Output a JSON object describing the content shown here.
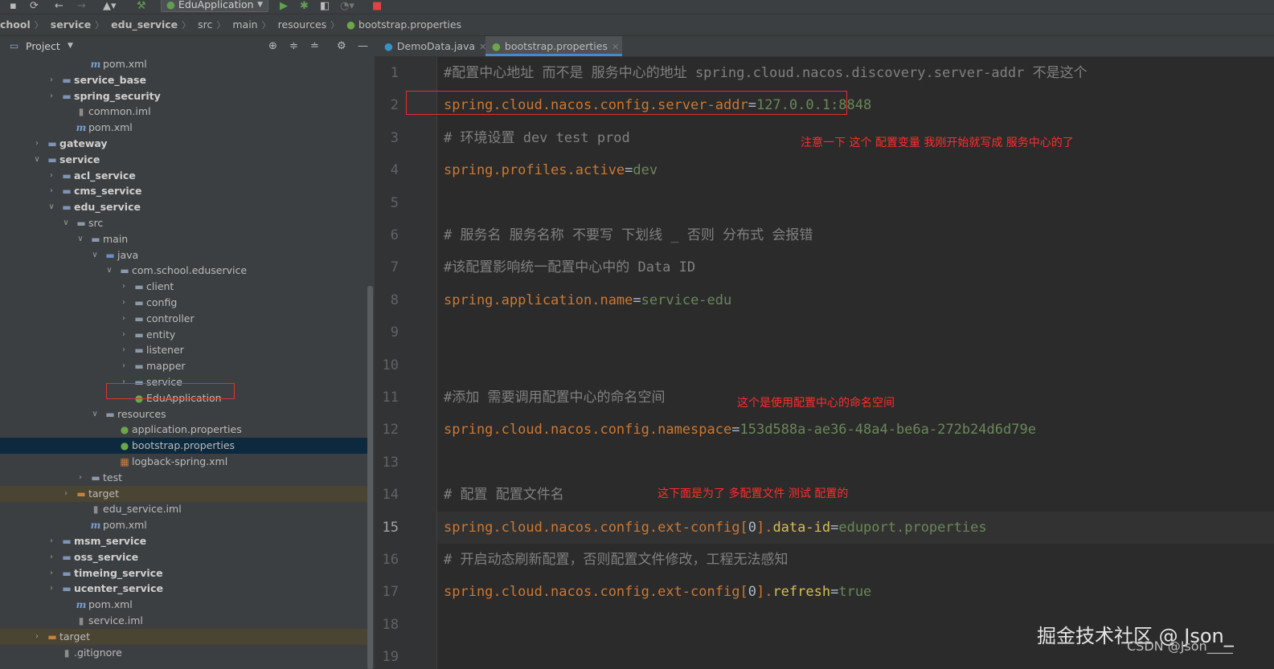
{
  "toolbar": {
    "run_config": "EduApplication",
    "icons": [
      "save-icon",
      "sync-icon",
      "back-icon",
      "forward-icon",
      "user-icon",
      "build-hammer-icon",
      "run-icon",
      "debug-icon",
      "coverage-icon",
      "profile-icon",
      "stop-icon"
    ]
  },
  "breadcrumb": [
    "chool",
    "service",
    "edu_service",
    "src",
    "main",
    "resources",
    "bootstrap.properties"
  ],
  "project_panel": {
    "title": "Project"
  },
  "tree": [
    {
      "label": "pom.xml",
      "icon": "maven",
      "level": 4,
      "arrow": ""
    },
    {
      "label": "service_base",
      "icon": "module",
      "level": 2,
      "arrow": "collapsed",
      "bold": true
    },
    {
      "label": "spring_security",
      "icon": "module",
      "level": 2,
      "arrow": "collapsed",
      "bold": true
    },
    {
      "label": "common.iml",
      "icon": "iml",
      "level": 3,
      "arrow": ""
    },
    {
      "label": "pom.xml",
      "icon": "maven",
      "level": 3,
      "arrow": ""
    },
    {
      "label": "gateway",
      "icon": "module",
      "level": 1,
      "arrow": "collapsed",
      "bold": true
    },
    {
      "label": "service",
      "icon": "module",
      "level": 1,
      "arrow": "expanded",
      "bold": true
    },
    {
      "label": "acl_service",
      "icon": "module",
      "level": 2,
      "arrow": "collapsed",
      "bold": true
    },
    {
      "label": "cms_service",
      "icon": "module",
      "level": 2,
      "arrow": "collapsed",
      "bold": true
    },
    {
      "label": "edu_service",
      "icon": "module",
      "level": 2,
      "arrow": "expanded",
      "bold": true
    },
    {
      "label": "src",
      "icon": "folder",
      "level": 3,
      "arrow": "expanded"
    },
    {
      "label": "main",
      "icon": "folder",
      "level": 4,
      "arrow": "expanded"
    },
    {
      "label": "java",
      "icon": "src",
      "level": 5,
      "arrow": "expanded"
    },
    {
      "label": "com.school.eduservice",
      "icon": "folder",
      "level": 6,
      "arrow": "expanded"
    },
    {
      "label": "client",
      "icon": "folder",
      "level": 7,
      "arrow": "collapsed"
    },
    {
      "label": "config",
      "icon": "folder",
      "level": 7,
      "arrow": "collapsed"
    },
    {
      "label": "controller",
      "icon": "folder",
      "level": 7,
      "arrow": "collapsed"
    },
    {
      "label": "entity",
      "icon": "folder",
      "level": 7,
      "arrow": "collapsed"
    },
    {
      "label": "listener",
      "icon": "folder",
      "level": 7,
      "arrow": "collapsed"
    },
    {
      "label": "mapper",
      "icon": "folder",
      "level": 7,
      "arrow": "collapsed"
    },
    {
      "label": "service",
      "icon": "folder",
      "level": 7,
      "arrow": "collapsed"
    },
    {
      "label": "EduApplication",
      "icon": "spring",
      "level": 7,
      "arrow": ""
    },
    {
      "label": "resources",
      "icon": "folder",
      "level": 5,
      "arrow": "expanded"
    },
    {
      "label": "application.properties",
      "icon": "spring",
      "level": 6,
      "arrow": ""
    },
    {
      "label": "bootstrap.properties",
      "icon": "spring",
      "level": 6,
      "arrow": "",
      "selected": true
    },
    {
      "label": "logback-spring.xml",
      "icon": "xml",
      "level": 6,
      "arrow": ""
    },
    {
      "label": "test",
      "icon": "folder",
      "level": 4,
      "arrow": "collapsed"
    },
    {
      "label": "target",
      "icon": "orange",
      "level": 3,
      "arrow": "collapsed",
      "excluded": true
    },
    {
      "label": "edu_service.iml",
      "icon": "iml",
      "level": 4,
      "arrow": ""
    },
    {
      "label": "pom.xml",
      "icon": "maven",
      "level": 4,
      "arrow": ""
    },
    {
      "label": "msm_service",
      "icon": "module",
      "level": 2,
      "arrow": "collapsed",
      "bold": true
    },
    {
      "label": "oss_service",
      "icon": "module",
      "level": 2,
      "arrow": "collapsed",
      "bold": true
    },
    {
      "label": "timeing_service",
      "icon": "module",
      "level": 2,
      "arrow": "collapsed",
      "bold": true
    },
    {
      "label": "ucenter_service",
      "icon": "module",
      "level": 2,
      "arrow": "collapsed",
      "bold": true
    },
    {
      "label": "pom.xml",
      "icon": "maven",
      "level": 3,
      "arrow": ""
    },
    {
      "label": "service.iml",
      "icon": "iml",
      "level": 3,
      "arrow": ""
    },
    {
      "label": "target",
      "icon": "orange",
      "level": 1,
      "arrow": "collapsed",
      "excluded": true
    },
    {
      "label": ".gitignore",
      "icon": "iml",
      "level": 2,
      "arrow": ""
    }
  ],
  "tabs": [
    {
      "label": "DemoData.java",
      "active": false
    },
    {
      "label": "bootstrap.properties",
      "active": true
    }
  ],
  "editor": {
    "current_line": 15,
    "lines": [
      [
        {
          "t": "#配置中心地址  而不是 服务中心的地址  spring.cloud.nacos.discovery.server-addr 不是这个",
          "c": "comment"
        }
      ],
      [
        {
          "t": "spring.cloud.nacos.config.server-addr",
          "c": "key"
        },
        {
          "t": "=",
          "c": "eq"
        },
        {
          "t": "127.0.0.1:8848",
          "c": "val"
        }
      ],
      [
        {
          "t": "# 环境设置 dev test prod",
          "c": "comment"
        }
      ],
      [
        {
          "t": "spring.profiles.active",
          "c": "key"
        },
        {
          "t": "=",
          "c": "eq"
        },
        {
          "t": "dev",
          "c": "val"
        }
      ],
      [],
      [
        {
          "t": "# 服务名  服务名称 不要写 下划线 _ 否则 分布式 会报错",
          "c": "comment"
        }
      ],
      [
        {
          "t": "#该配置影响统一配置中心中的 Data ID",
          "c": "comment"
        }
      ],
      [
        {
          "t": "spring.application.name",
          "c": "key"
        },
        {
          "t": "=",
          "c": "eq"
        },
        {
          "t": "service-edu",
          "c": "val"
        }
      ],
      [],
      [],
      [
        {
          "t": "#添加 需要调用配置中心的命名空间",
          "c": "comment"
        }
      ],
      [
        {
          "t": "spring.cloud.nacos.config.namespace",
          "c": "key"
        },
        {
          "t": "=",
          "c": "eq"
        },
        {
          "t": "153d588a-ae36-48a4-be6a-272b24d6d79e",
          "c": "val"
        }
      ],
      [],
      [
        {
          "t": "# 配置 配置文件名",
          "c": "comment"
        }
      ],
      [
        {
          "t": "spring.cloud.nacos.config.ext-config[",
          "c": "key"
        },
        {
          "t": "0",
          "c": "eq"
        },
        {
          "t": "].",
          "c": "key"
        },
        {
          "t": "data-id",
          "c": "kw"
        },
        {
          "t": "=",
          "c": "eq"
        },
        {
          "t": "eduport.properties",
          "c": "val"
        }
      ],
      [
        {
          "t": "# 开启动态刷新配置，否则配置文件修改，工程无法感知",
          "c": "comment"
        }
      ],
      [
        {
          "t": "spring.cloud.nacos.config.ext-config[",
          "c": "key"
        },
        {
          "t": "0",
          "c": "eq"
        },
        {
          "t": "].",
          "c": "key"
        },
        {
          "t": "refresh",
          "c": "kw"
        },
        {
          "t": "=",
          "c": "eq"
        },
        {
          "t": "true",
          "c": "val"
        }
      ],
      [],
      []
    ],
    "line_numbers": [
      "1",
      "2",
      "3",
      "4",
      "5",
      "6",
      "7",
      "8",
      "9",
      "10",
      "11",
      "12",
      "13",
      "14",
      "15",
      "16",
      "17",
      "18",
      "19"
    ]
  },
  "annotations": {
    "note1": "注意一下 这个 配置变量  我刚开始就写成 服务中心的了",
    "note2": "这个是使用配置中心的命名空间",
    "note3": "这下面是为了  多配置文件 测试 配置的"
  },
  "watermark": {
    "main": "掘金技术社区 @ Json_",
    "sub": "CSDN @Json____"
  }
}
